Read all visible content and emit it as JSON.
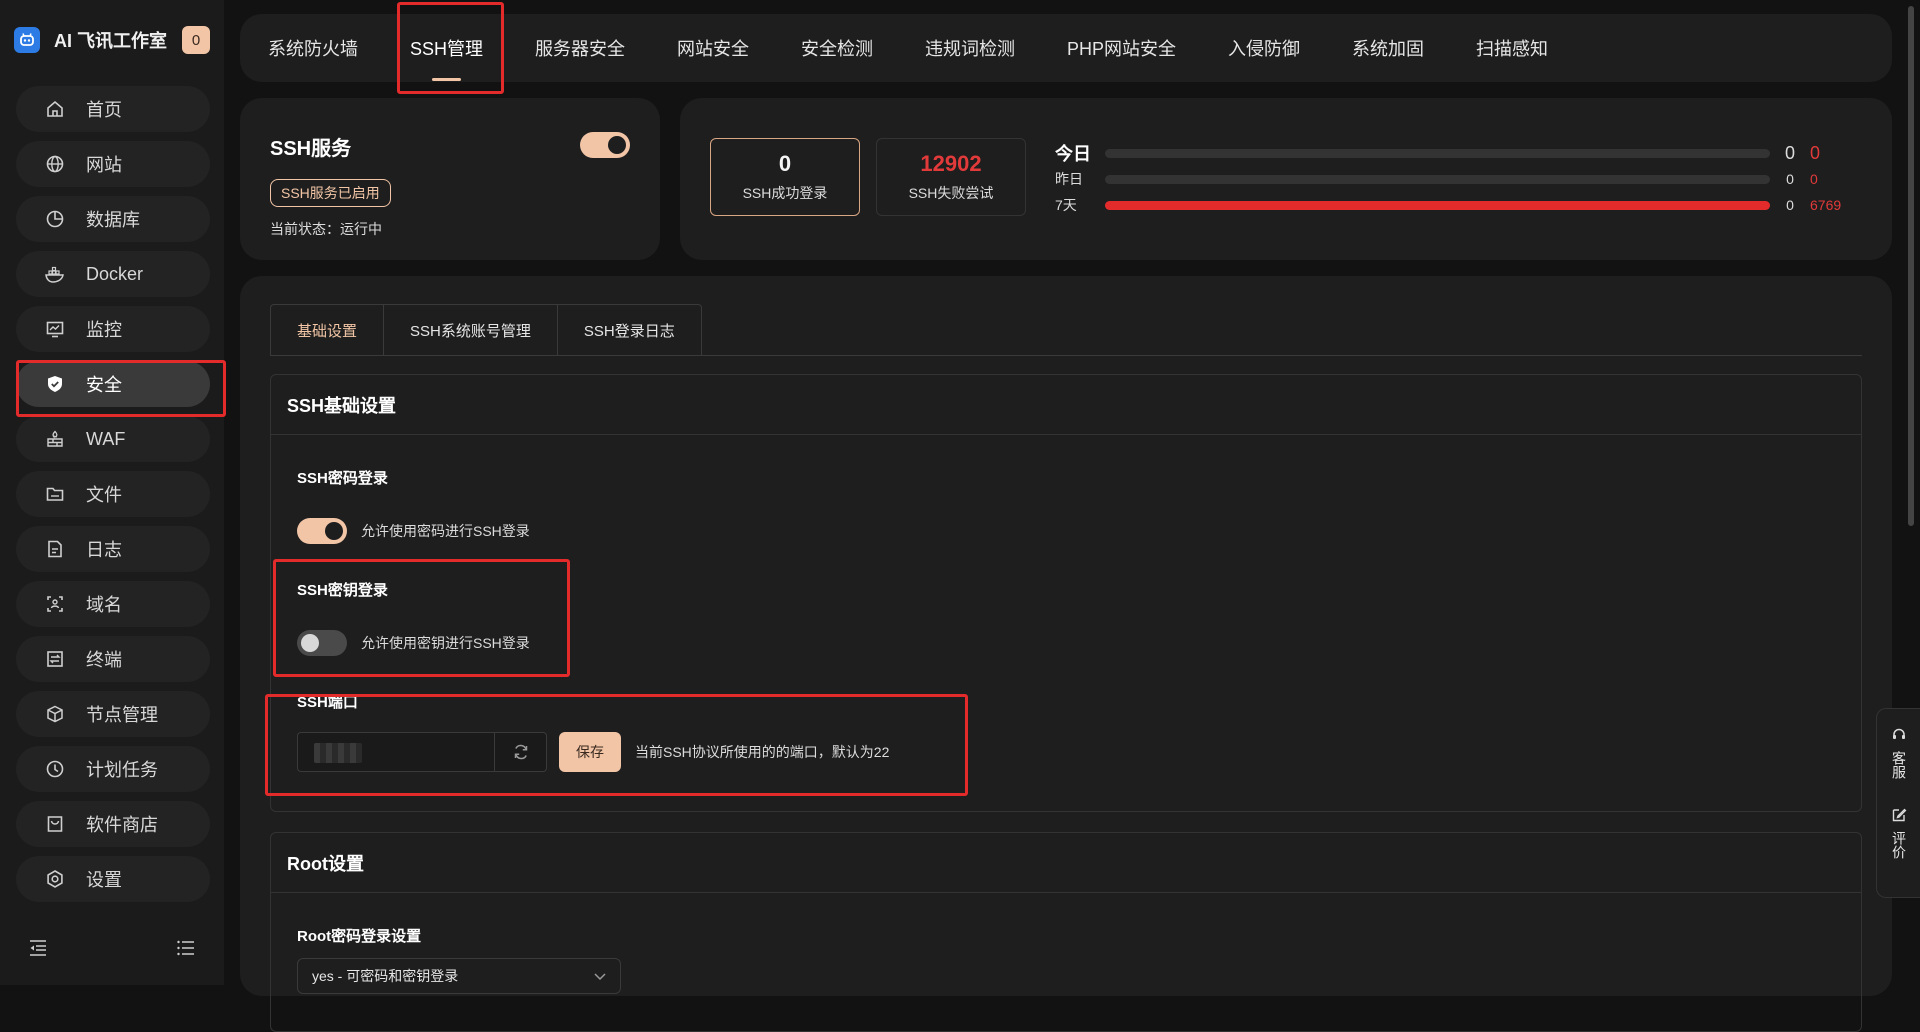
{
  "app": {
    "brand_name": "AI 飞讯工作室",
    "badge": "0"
  },
  "sidebar": {
    "items": [
      {
        "label": "首页",
        "icon": "home-icon"
      },
      {
        "label": "网站",
        "icon": "globe-icon"
      },
      {
        "label": "数据库",
        "icon": "database-icon"
      },
      {
        "label": "Docker",
        "icon": "docker-icon"
      },
      {
        "label": "监控",
        "icon": "monitor-icon"
      },
      {
        "label": "安全",
        "icon": "shield-icon",
        "active": true
      },
      {
        "label": "WAF",
        "icon": "firewall-icon"
      },
      {
        "label": "文件",
        "icon": "folder-icon"
      },
      {
        "label": "日志",
        "icon": "log-icon"
      },
      {
        "label": "域名",
        "icon": "domain-icon"
      },
      {
        "label": "终端",
        "icon": "terminal-icon"
      },
      {
        "label": "节点管理",
        "icon": "cube-icon"
      },
      {
        "label": "计划任务",
        "icon": "clock-icon"
      },
      {
        "label": "软件商店",
        "icon": "store-icon"
      },
      {
        "label": "设置",
        "icon": "settings-icon"
      }
    ]
  },
  "topbar": {
    "tabs": [
      "系统防火墙",
      "SSH管理",
      "服务器安全",
      "网站安全",
      "安全检测",
      "违规词检测",
      "PHP网站安全",
      "入侵防御",
      "系统加固",
      "扫描感知"
    ],
    "active_index": 1
  },
  "ssh_card": {
    "title": "SSH服务",
    "enabled": true,
    "badge": "SSH服务已启用",
    "status": "当前状态：运行中"
  },
  "stats": {
    "success_value": "0",
    "success_label": "SSH成功登录",
    "fail_value": "12902",
    "fail_label": "SSH失败尝试",
    "rows": [
      {
        "label": "今日",
        "v1": "0",
        "v2": "0",
        "fill": 0
      },
      {
        "label": "昨日",
        "v1": "0",
        "v2": "0",
        "fill": 0
      },
      {
        "label": "7天",
        "v1": "0",
        "v2": "6769",
        "fill": 1.0
      }
    ]
  },
  "panel": {
    "tabs": [
      "基础设置",
      "SSH系统账号管理",
      "SSH登录日志"
    ],
    "basic": {
      "title": "SSH基础设置",
      "password_login": {
        "label": "SSH密码登录",
        "desc": "允许使用密码进行SSH登录",
        "on": true
      },
      "key_login": {
        "label": "SSH密钥登录",
        "desc": "允许使用密钥进行SSH登录",
        "on": false
      },
      "port": {
        "label": "SSH端口",
        "save": "保存",
        "desc": "当前SSH协议所使用的的端口，默认为22"
      }
    },
    "root": {
      "title": "Root设置",
      "password_label": "Root密码登录设置",
      "select_value": "yes - 可密码和密钥登录"
    }
  },
  "float": {
    "service": "客服",
    "review": "评价"
  },
  "colors": {
    "accent": "#f2c5a6",
    "danger": "#e32b2b",
    "bg": "#121212",
    "card": "#1e1e1e"
  }
}
